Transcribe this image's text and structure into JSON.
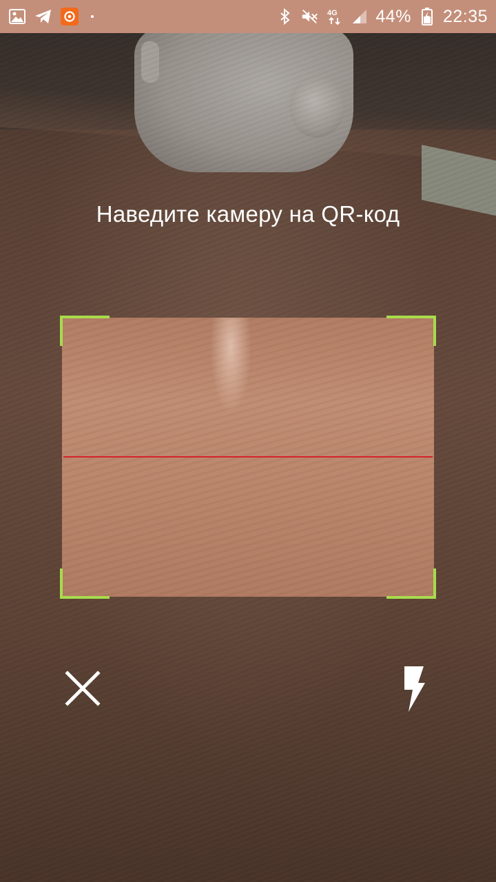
{
  "status_bar": {
    "icons_left": [
      "gallery-icon",
      "telegram-icon",
      "orange-app-icon",
      "notification-dot"
    ],
    "icons_right": [
      "bluetooth-icon",
      "mute-icon",
      "4g-icon",
      "signal-icon",
      "battery-icon"
    ],
    "battery": "44%",
    "time": "22:35",
    "network": "4G",
    "background_color": "#c48f7a"
  },
  "scanner": {
    "instruction": "Наведите камеру на QR-код",
    "frame_corner_color": "#a8dc4c",
    "laser_color": "#d4242a"
  },
  "controls": {
    "close_icon": "close-icon",
    "flash_icon": "flash-icon"
  }
}
